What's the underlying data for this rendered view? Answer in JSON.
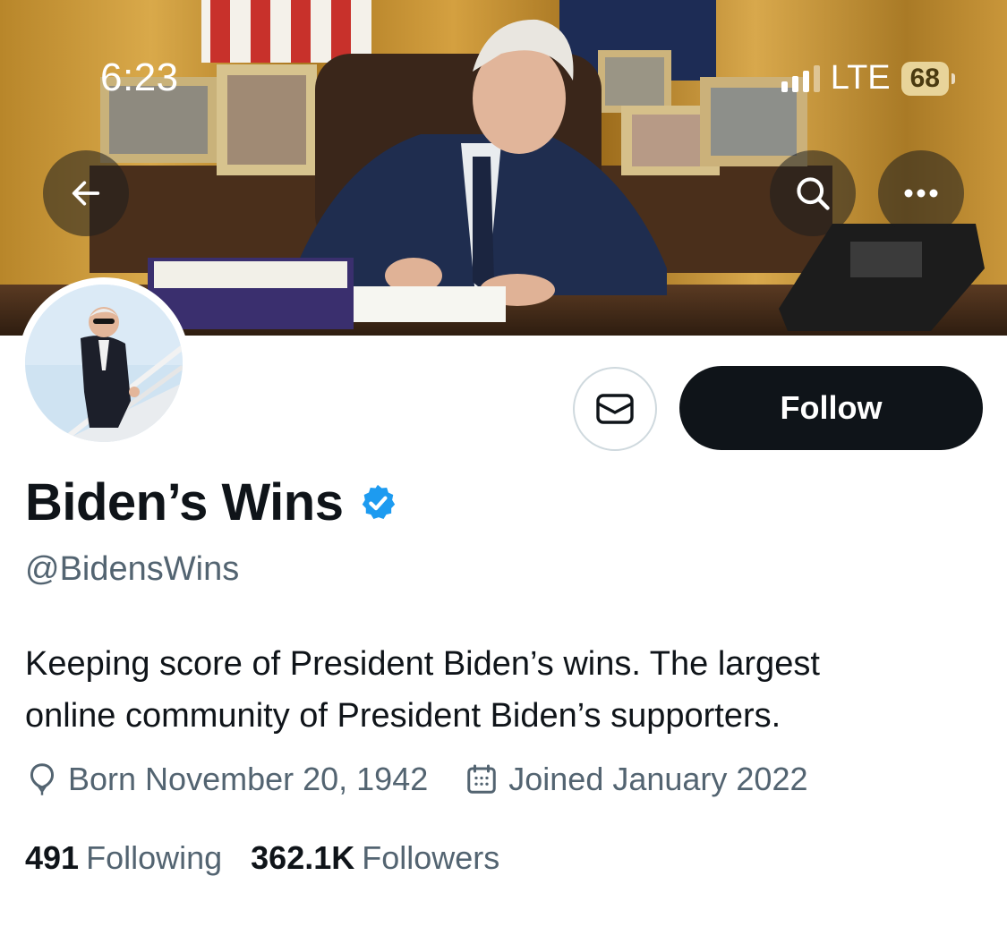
{
  "status_bar": {
    "time": "6:23",
    "network": "LTE",
    "battery": "68"
  },
  "header": {
    "back_icon": "arrow-left-icon",
    "search_icon": "search-icon",
    "more_icon": "more-horizontal-icon"
  },
  "actions": {
    "message_icon": "envelope-icon",
    "follow_label": "Follow"
  },
  "profile": {
    "name": "Biden’s Wins",
    "verified": true,
    "handle": "@BidensWins",
    "bio_lines": [
      "Keeping score of President Biden’s wins. The largest",
      "online community of President Biden’s supporters."
    ],
    "born": "Born November 20, 1942",
    "joined": "Joined January 2022",
    "following_count": "491",
    "following_label": "Following",
    "followers_count": "362.1K",
    "followers_label": "Followers"
  },
  "colors": {
    "accent_verified": "#1d9bf0",
    "text_primary": "#0f1419",
    "text_secondary": "#536471",
    "follow_bg": "#0f1419"
  }
}
